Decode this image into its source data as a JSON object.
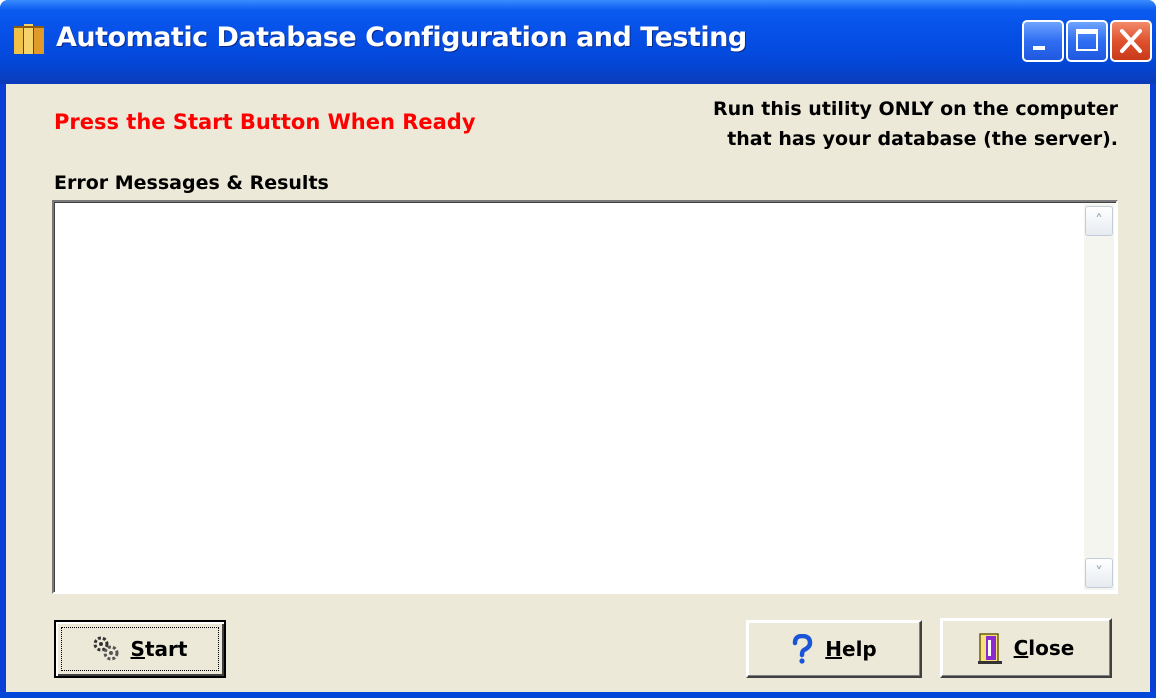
{
  "window": {
    "title": "Automatic Database Configuration and Testing",
    "controls": {
      "minimize": "minimize-icon",
      "maximize": "maximize-icon",
      "close": "close-icon"
    }
  },
  "status": {
    "prompt": "Press the Start Button When Ready",
    "prompt_color": "#ff0000"
  },
  "notice": {
    "text": "Run this utility ONLY on the computer\nthat has your database (the server)."
  },
  "results": {
    "label": "Error Messages & Results",
    "content": ""
  },
  "buttons": {
    "start": {
      "access_key": "S",
      "rest": "tart",
      "icon": "gears-icon"
    },
    "help": {
      "access_key": "H",
      "rest": "elp",
      "icon": "question-mark-icon"
    },
    "close": {
      "access_key": "C",
      "rest": "lose",
      "icon": "exit-door-icon"
    }
  }
}
